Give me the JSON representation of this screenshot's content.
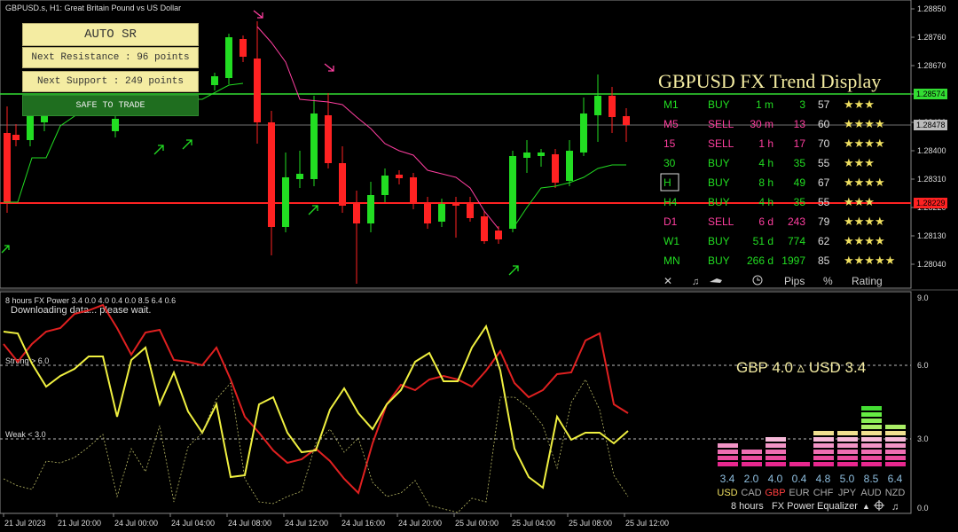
{
  "window": {
    "title": "GBPUSD.s, H1:  Great Britain Pound vs US Dollar"
  },
  "price_scale": {
    "ticks": [
      "1.28850",
      "1.28760",
      "1.28670",
      "1.28580",
      "1.28490",
      "1.28400",
      "1.28310",
      "1.28220",
      "1.28130",
      "1.28040"
    ],
    "resistance_tag": "1.28574",
    "current_tag": "1.28478",
    "support_tag": "1.28229"
  },
  "sr_panel": {
    "title": "AUTO SR",
    "next_resistance": "Next Resistance : 96 points",
    "next_support": "Next Support : 249 points",
    "status": "SAFE TO TRADE"
  },
  "trend_display": {
    "title": "GBPUSD FX Trend Display",
    "rows": [
      {
        "tf": "M1",
        "dir": "BUY",
        "dur": "1 m",
        "pips": "3",
        "pct": "57",
        "stars": "★★★",
        "color": "#22dd22"
      },
      {
        "tf": "M5",
        "dir": "SELL",
        "dur": "30 m",
        "pips": "13",
        "pct": "60",
        "stars": "★★★★",
        "color": "#ff3fa0"
      },
      {
        "tf": "15",
        "dir": "SELL",
        "dur": "1 h",
        "pips": "17",
        "pct": "70",
        "stars": "★★★★",
        "color": "#ff3fa0"
      },
      {
        "tf": "30",
        "dir": "BUY",
        "dur": "4 h",
        "pips": "35",
        "pct": "55",
        "stars": "★★★",
        "color": "#22dd22"
      },
      {
        "tf": "H",
        "dir": "BUY",
        "dur": "8 h",
        "pips": "49",
        "pct": "67",
        "stars": "★★★★",
        "color": "#22dd22"
      },
      {
        "tf": "H4",
        "dir": "BUY",
        "dur": "4 h",
        "pips": "35",
        "pct": "55",
        "stars": "★★★",
        "color": "#22dd22"
      },
      {
        "tf": "D1",
        "dir": "SELL",
        "dur": "6 d",
        "pips": "243",
        "pct": "79",
        "stars": "★★★★",
        "color": "#ff3fa0"
      },
      {
        "tf": "W1",
        "dir": "BUY",
        "dur": "51 d",
        "pips": "774",
        "pct": "62",
        "stars": "★★★★",
        "color": "#22dd22"
      },
      {
        "tf": "MN",
        "dir": "BUY",
        "dur": "266 d",
        "pips": "1997",
        "pct": "85",
        "stars": "★★★★★",
        "color": "#22dd22"
      }
    ],
    "footer": {
      "close": "✕",
      "pips": "Pips",
      "pct": "%",
      "rating": "Rating"
    }
  },
  "sub_window": {
    "title": "8 hours FX Power 3.4 0.0 4.0 0.4 0.0 8.5 6.4 0.6",
    "status": "Downloading data... please wait.",
    "strong_label": "Strong > 6.0",
    "weak_label": "Weak < 3.0",
    "scale": [
      "9.0",
      "6.0",
      "3.0",
      "0.0"
    ],
    "pair_readout": "GBP 4.0   ▵  USD 3.4"
  },
  "equalizer": {
    "values": [
      "3.4",
      "2.0",
      "4.0",
      "0.4",
      "4.8",
      "5.0",
      "8.5",
      "6.4"
    ],
    "currencies": [
      "USD",
      "CAD",
      "GBP",
      "EUR",
      "CHF",
      "JPY",
      "AUD",
      "NZD"
    ],
    "footer": [
      "8 hours",
      "FX Power",
      "Equalizer"
    ]
  },
  "time_axis": [
    "21 Jul 2023",
    "21 Jul 20:00",
    "24 Jul 00:00",
    "24 Jul 04:00",
    "24 Jul 08:00",
    "24 Jul 12:00",
    "24 Jul 16:00",
    "24 Jul 20:00",
    "25 Jul 00:00",
    "25 Jul 04:00",
    "25 Jul 08:00",
    "25 Jul 12:00"
  ],
  "colors": {
    "bull": "#22dd22",
    "bear": "#ff2222",
    "support": "#ff2222",
    "resistance": "#33dd33",
    "buy": "#22dd22",
    "sell": "#ff3fa0",
    "gbp_line": "#e02020",
    "usd_line": "#f0f040"
  }
}
